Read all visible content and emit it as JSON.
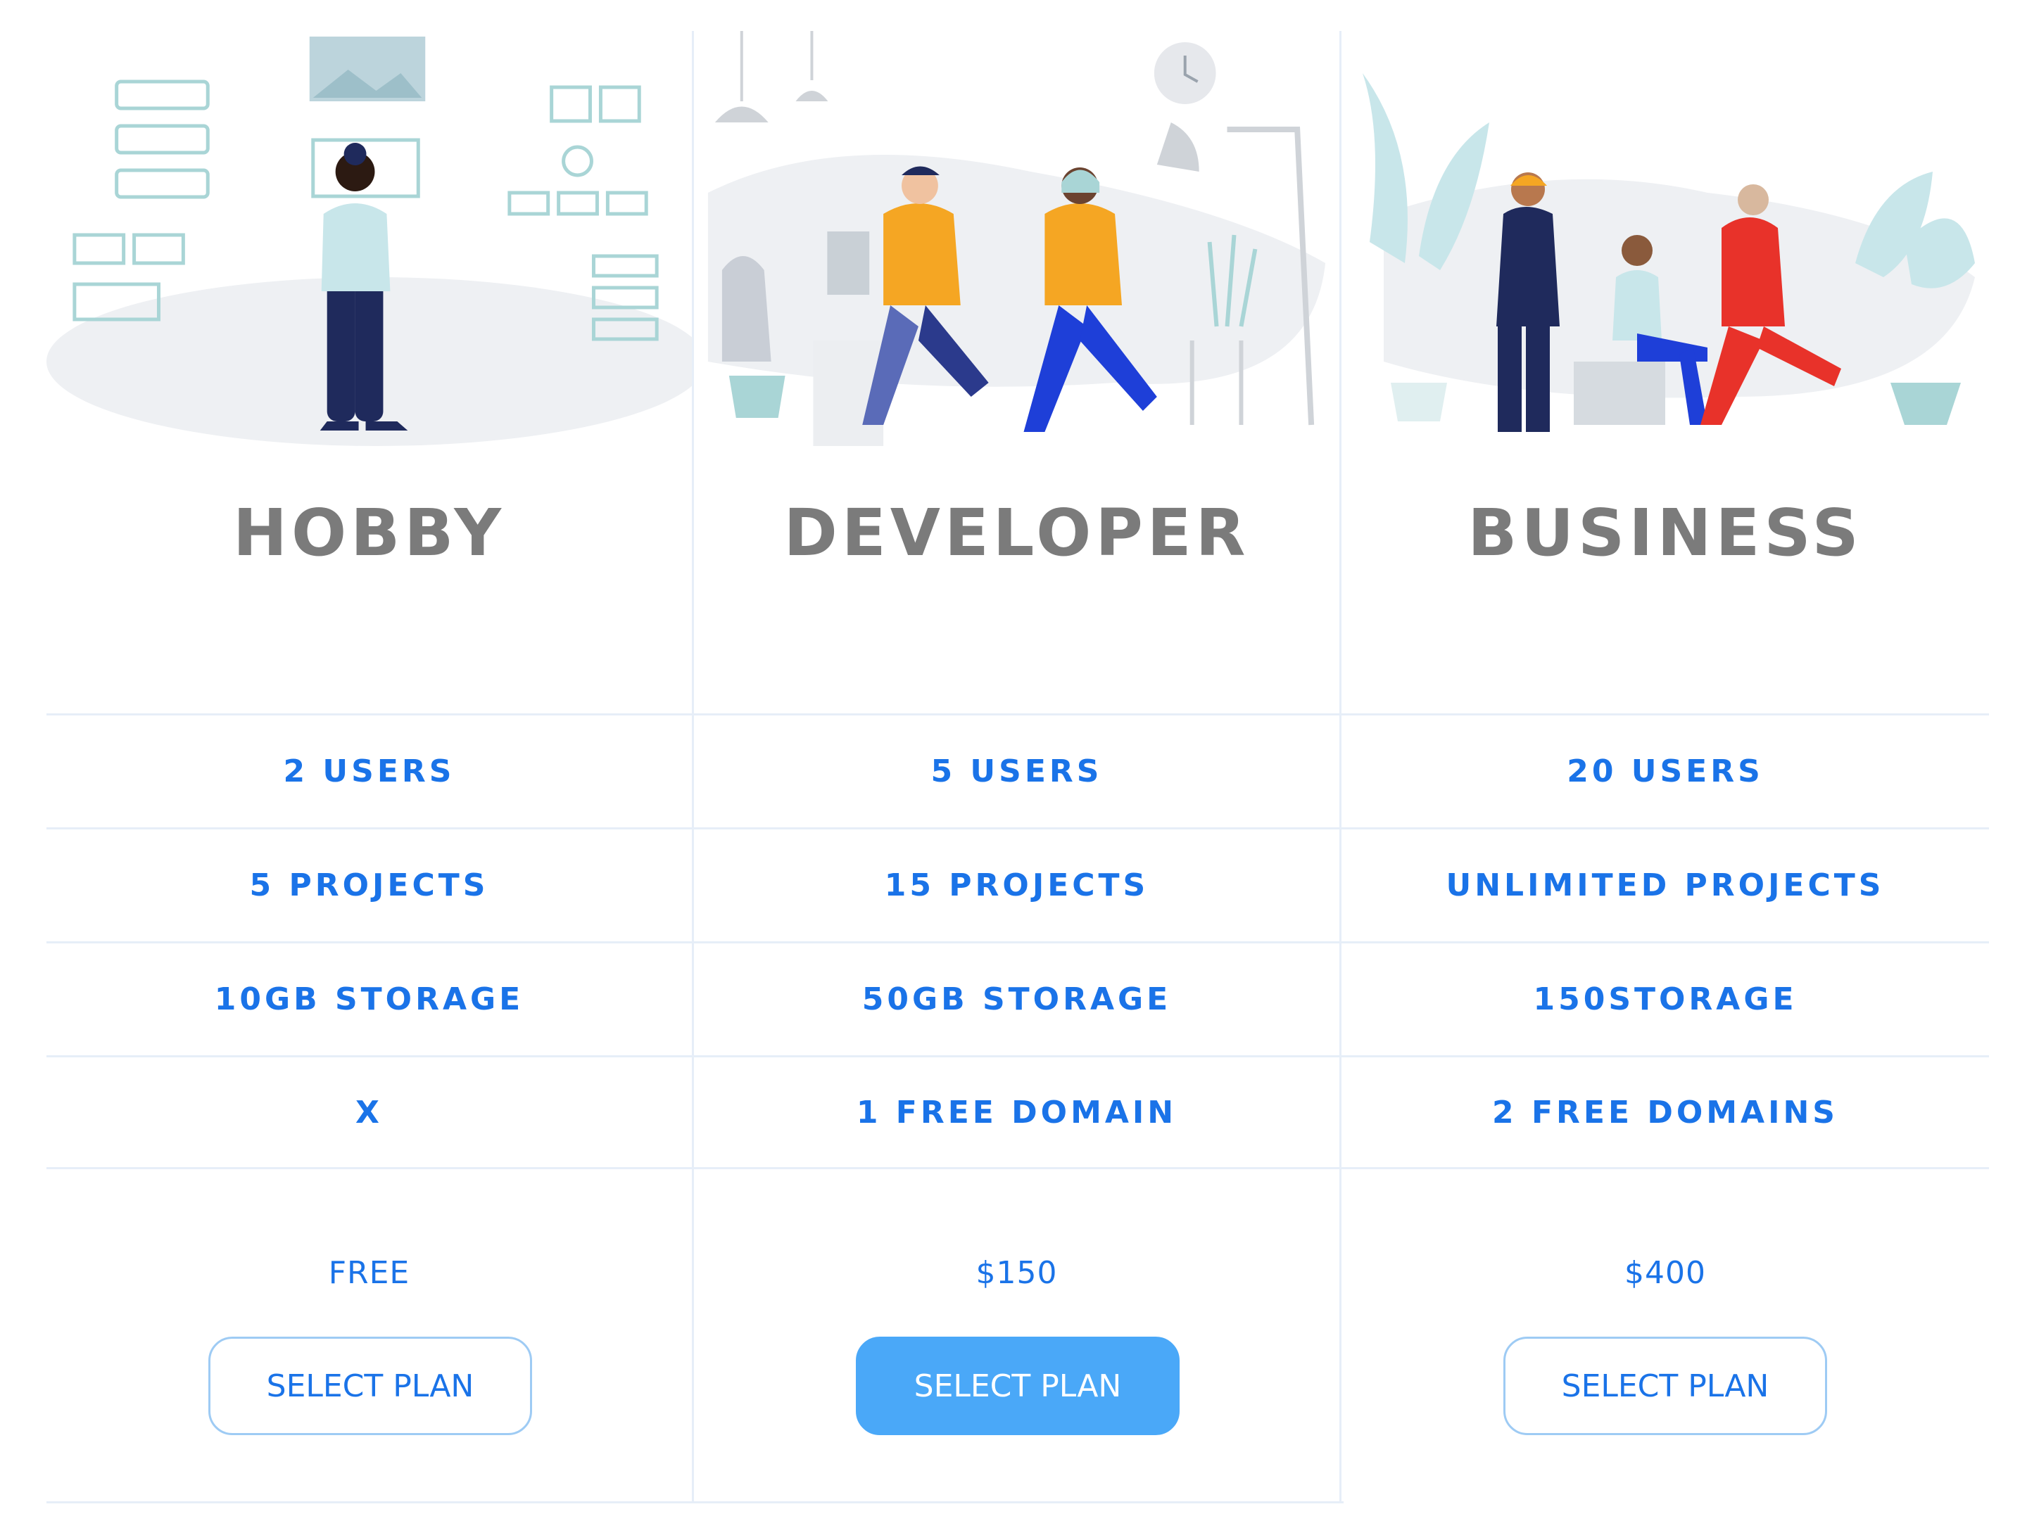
{
  "plans": [
    {
      "name": "HOBBY",
      "features": [
        "2 USERS",
        "5 PROJECTS",
        "10GB STORAGE",
        "X"
      ],
      "price": "FREE",
      "button_label": "SELECT PLAN",
      "button_style": "outline"
    },
    {
      "name": "DEVELOPER",
      "features": [
        "5 USERS",
        "15 PROJECTS",
        "50GB STORAGE",
        "1 FREE DOMAIN"
      ],
      "price": "$150",
      "button_label": "SELECT PLAN",
      "button_style": "filled"
    },
    {
      "name": "BUSINESS",
      "features": [
        "20 USERS",
        "UNLIMITED PROJECTS",
        "150STORAGE",
        "2 FREE DOMAINS"
      ],
      "price": "$400",
      "button_label": "SELECT PLAN",
      "button_style": "outline"
    }
  ],
  "colors": {
    "accent": "#1a73e8",
    "button_fill": "#4aa8f8",
    "plan_name": "#7b7b7b",
    "divider": "#e6eef8"
  },
  "illustrations": [
    "wireframe-person-illustration",
    "two-people-walking-illustration",
    "team-meeting-illustration"
  ]
}
